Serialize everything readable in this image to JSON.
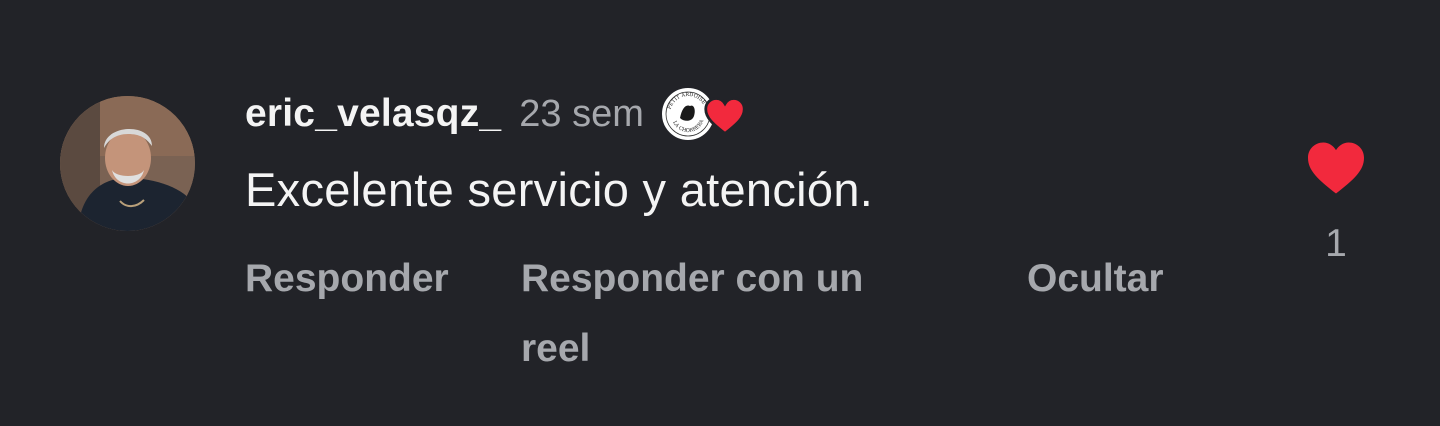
{
  "comment": {
    "username": "eric_velasqz_",
    "timestamp": "23 sem",
    "text": "Excelente servicio y atención.",
    "creator_liked_icon": "creator-liked-heart-icon",
    "creator_badge_text": [
      "PETIT ARDOISE",
      "LA CHORRERA"
    ],
    "actions": {
      "reply": "Responder",
      "reply_reel": "Responder con un reel",
      "hide": "Ocultar"
    },
    "like": {
      "icon": "heart-icon",
      "count": "1",
      "liked": true,
      "color": "#f2293d"
    }
  },
  "colors": {
    "background": "#222328",
    "primary_text": "#f4f4f4",
    "secondary_text": "#a6a8ad",
    "heart": "#f2293d"
  }
}
